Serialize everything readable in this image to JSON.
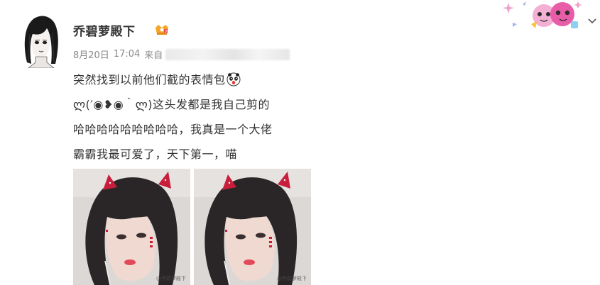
{
  "post": {
    "author": {
      "name": "乔碧萝殿下",
      "avatar_icon": "anime-girl-avatar-icon",
      "badge_icon": "vip-crown-icon"
    },
    "meta": {
      "date": "8月20日",
      "time": "17:04",
      "source_prefix": "来自"
    },
    "content": {
      "line1": "突然找到以前他们截的表情包",
      "line1_emoji": "panda-sticker-icon",
      "line2": "ლ(′◉❥◉｀ლ)这头发都是我自己剪的",
      "line3": "哈哈哈哈哈哈哈哈哈，我真是一个大佬",
      "line4": "霸霸我最可爱了，天下第一，喵"
    },
    "images": [
      {
        "watermark": "@乔碧萝殿下"
      },
      {
        "watermark": "@乔碧萝殿下"
      }
    ]
  },
  "header_decor": "cartoon-sticker-decoration",
  "menu_icon": "chevron-down-icon",
  "colors": {
    "text": "#333333",
    "meta": "#8a8a8a",
    "badge": "#f5a623"
  }
}
